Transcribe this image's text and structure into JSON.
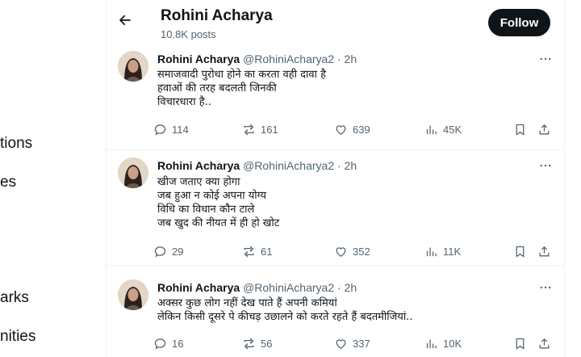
{
  "left_nav": {
    "items": [
      "tions",
      "es",
      "arks",
      "nities"
    ]
  },
  "header": {
    "name": "Rohini Acharya",
    "posts": "10.8K posts",
    "follow_label": "Follow"
  },
  "tweets": [
    {
      "name": "Rohini Acharya",
      "handle_time": "@RohiniAcharya2 · 2h",
      "body": "समाजवादी पुरोधा होने का करता वही दावा है\nहवाओं की तरह बदलती जिनकी\nविचारधारा है..",
      "replies": "114",
      "reposts": "161",
      "likes": "639",
      "views": "45K"
    },
    {
      "name": "Rohini Acharya",
      "handle_time": "@RohiniAcharya2 · 2h",
      "body": "खीज जताए क्या होगा\nजब हुआ न कोई अपना योग्य\nविधि का विधान कौन टाले\nजब खुद की नीयत में ही हो खोट",
      "replies": "29",
      "reposts": "61",
      "likes": "352",
      "views": "11K"
    },
    {
      "name": "Rohini Acharya",
      "handle_time": "@RohiniAcharya2 · 2h",
      "body": "अक्सर कुछ लोग नहीं देख पाते हैं अपनी कमियां\nलेकिन किसी दूसरे पे कीचड़ उछालने को करते रहते हैं बदतमीजियां..",
      "replies": "16",
      "reposts": "56",
      "likes": "337",
      "views": "10K"
    }
  ],
  "icons": {
    "back": "arrow-left-icon",
    "more": "more-horizontal-icon",
    "reply": "reply-icon",
    "repost": "repost-icon",
    "like": "heart-icon",
    "views": "views-icon",
    "bookmark": "bookmark-icon",
    "share": "share-icon"
  }
}
